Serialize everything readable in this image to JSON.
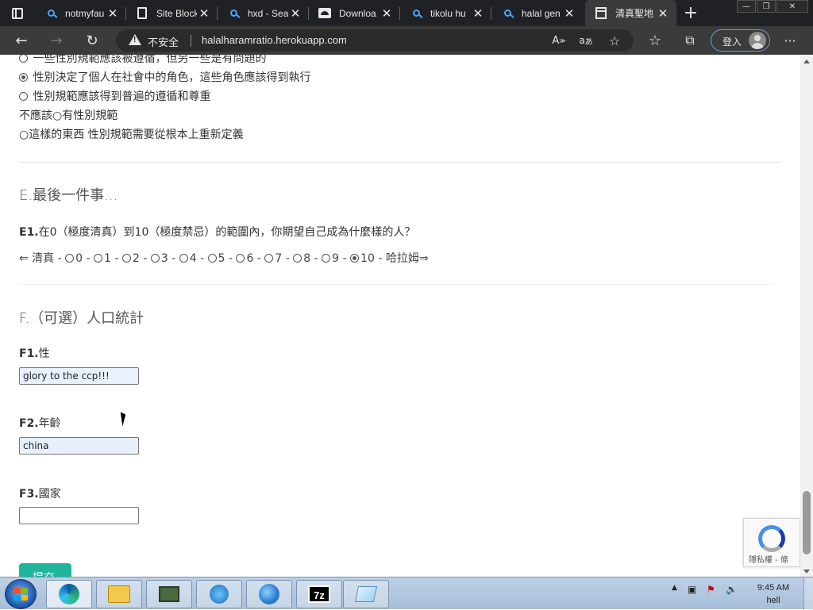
{
  "browser": {
    "tabs": [
      {
        "title": "notmyfau",
        "icon": "search-icon",
        "close": "✕"
      },
      {
        "title": "Site Block",
        "icon": "document-icon",
        "close": "✕"
      },
      {
        "title": "hxd - Sea",
        "icon": "search-icon",
        "close": "✕"
      },
      {
        "title": "Downloa",
        "icon": "cloud-icon",
        "close": "✕"
      },
      {
        "title": "tikolu hu",
        "icon": "search-icon",
        "close": "✕"
      },
      {
        "title": "halal gen",
        "icon": "search-icon",
        "close": "✕"
      },
      {
        "title": "清真聖地",
        "icon": "calendar-icon",
        "close": "✕",
        "active": true
      }
    ],
    "new_tab": "+",
    "insecure_label": "不安全",
    "url": "halalharamratio.herokuapp.com",
    "signin_label": "登入",
    "more": "···",
    "read_aloud": "A",
    "translate": "あ"
  },
  "page": {
    "prev_options": [
      {
        "text": "一些性別規範應該被遵循，但另一些是有問題的",
        "selected": false
      },
      {
        "text": "性別決定了個人在社會中的角色，這些角色應該得到執行",
        "selected": true
      },
      {
        "text": "性別規範應該得到普遍的遵循和尊重",
        "selected": false
      }
    ],
    "wrapped_option_line1": "不應該○有性別規範",
    "wrapped_option_line2": "○這樣的東西 性別規範需要從根本上重新定義",
    "section_e_title": "E.最後一件事...",
    "e1": {
      "number": "E1.",
      "question": "在0（極度清真）到10（極度禁忌）的範圍內，你期望自己成為什麼樣的人？",
      "number_bold_0": "0",
      "number_bold_10": "10",
      "left_label": "⇐ 清真 -",
      "right_label": "- 哈拉姆⇒",
      "options": [
        "0",
        "1",
        "2",
        "3",
        "4",
        "5",
        "6",
        "7",
        "8",
        "9",
        "10"
      ],
      "selected": "10"
    },
    "section_f_title": "F.（可選）人口統計",
    "f1": {
      "number": "F1.",
      "label": "性",
      "value": "glory to the ccp!!!"
    },
    "f2": {
      "number": "F2.",
      "label": "年齡",
      "value": "china"
    },
    "f3": {
      "number": "F3.",
      "label": "國家",
      "value": ""
    },
    "submit_label": "提交",
    "recaptcha_text": "隱私權 - 條"
  },
  "taskbar": {
    "apps": [
      "edge-icon",
      "file-explorer-icon",
      "device-manager-icon",
      "network-task-icon",
      "internet-globe-icon",
      "7zip-icon",
      "notepad-icon"
    ],
    "time": "9:45 AM",
    "user": "hell"
  },
  "colors": {
    "accent_button": "#1fb59a",
    "tab_bar": "#202124",
    "toolbar": "#3b3b3b"
  }
}
